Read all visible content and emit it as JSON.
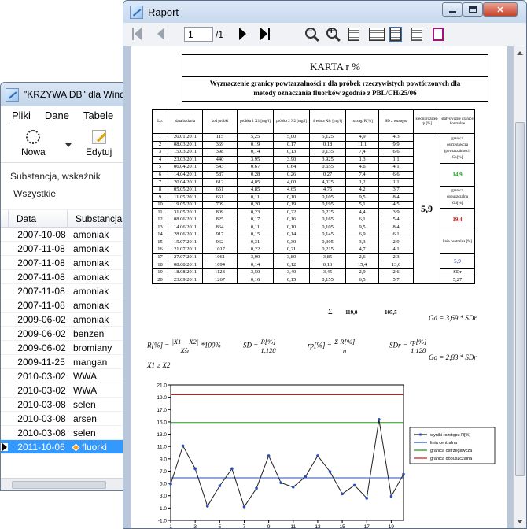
{
  "back_window": {
    "title": "\"KRZYWA DB\" dla Windo",
    "menu": [
      "Pliki",
      "Dane",
      "Tabele"
    ],
    "toolbar": {
      "new_label": "Nowa",
      "edit_label": "Edytuj"
    },
    "filter": {
      "label": "Substancja, wskaźnik",
      "value": "Wszystkie"
    },
    "grid": {
      "columns": [
        "Data",
        "Substancja"
      ],
      "rows": [
        {
          "date": "2007-10-08",
          "substance": "amoniak"
        },
        {
          "date": "2007-11-08",
          "substance": "amoniak"
        },
        {
          "date": "2007-11-08",
          "substance": "amoniak"
        },
        {
          "date": "2007-11-08",
          "substance": "amoniak"
        },
        {
          "date": "2007-11-08",
          "substance": "amoniak"
        },
        {
          "date": "2007-11-08",
          "substance": "amoniak"
        },
        {
          "date": "2009-06-02",
          "substance": "amoniak"
        },
        {
          "date": "2009-06-02",
          "substance": "benzen"
        },
        {
          "date": "2009-06-02",
          "substance": "bromiany"
        },
        {
          "date": "2009-11-25",
          "substance": "mangan"
        },
        {
          "date": "2010-03-02",
          "substance": "WWA"
        },
        {
          "date": "2010-03-02",
          "substance": "WWA"
        },
        {
          "date": "2010-03-08",
          "substance": "selen"
        },
        {
          "date": "2010-03-08",
          "substance": "arsen"
        },
        {
          "date": "2010-03-08",
          "substance": "selen"
        },
        {
          "date": "2011-10-06",
          "substance": "fluorki"
        }
      ]
    }
  },
  "front_window": {
    "title": "Raport",
    "toolbar": {
      "page_value": "1",
      "page_total": "/1"
    }
  },
  "report": {
    "title": "KARTA r %",
    "subtitle_line1": "Wyznaczenie granicy powtarzalności r dla próbek rzeczywistych powtórzonych dla",
    "subtitle_line2": "metody oznaczania fluorków zgodnie z  PBL/CH/25/06",
    "headers": {
      "lp": "Lp.",
      "date": "data badania",
      "code": "kod próbki",
      "x1": "próbka 1 X1 [mg/l]",
      "x2": "próbka 2 X2 [mg/l]",
      "mean": "średnia Xśr [mg/l]",
      "range": "rozstęp R[%]",
      "sd": "SD z rozstępu",
      "mean_range": "średni rozstęp rp [%]",
      "limits": "statystyczne granice kontrolne"
    },
    "rows": [
      {
        "lp": "1",
        "date": "20.01.2011",
        "code": "115",
        "x1": "5,25",
        "x2": "5,00",
        "mean": "5,125",
        "r": "4,9",
        "sd": "4,3"
      },
      {
        "lp": "2",
        "date": "08.03.2011",
        "code": "369",
        "x1": "0,19",
        "x2": "0,17",
        "mean": "0,18",
        "r": "11,1",
        "sd": "9,9"
      },
      {
        "lp": "3",
        "date": "15.03.2011",
        "code": "398",
        "x1": "0,14",
        "x2": "0,13",
        "mean": "0,135",
        "r": "7,4",
        "sd": "6,6"
      },
      {
        "lp": "4",
        "date": "23.03.2011",
        "code": "440",
        "x1": "3,95",
        "x2": "3,90",
        "mean": "3,925",
        "r": "1,3",
        "sd": "1,1"
      },
      {
        "lp": "5",
        "date": "06.04.2011",
        "code": "543",
        "x1": "0,67",
        "x2": "0,64",
        "mean": "0,655",
        "r": "4,6",
        "sd": "4,1"
      },
      {
        "lp": "6",
        "date": "14.04.2011",
        "code": "587",
        "x1": "0,28",
        "x2": "0,26",
        "mean": "0,27",
        "r": "7,4",
        "sd": "6,6"
      },
      {
        "lp": "7",
        "date": "20.04.2011",
        "code": "612",
        "x1": "4,05",
        "x2": "4,00",
        "mean": "4,025",
        "r": "1,2",
        "sd": "1,1"
      },
      {
        "lp": "8",
        "date": "05.05.2011",
        "code": "651",
        "x1": "4,85",
        "x2": "4,65",
        "mean": "4,75",
        "r": "4,2",
        "sd": "3,7"
      },
      {
        "lp": "9",
        "date": "11.05.2011",
        "code": "661",
        "x1": "0,11",
        "x2": "0,10",
        "mean": "0,105",
        "r": "9,5",
        "sd": "8,4"
      },
      {
        "lp": "10",
        "date": "19.05.2011",
        "code": "709",
        "x1": "0,20",
        "x2": "0,19",
        "mean": "0,195",
        "r": "5,1",
        "sd": "4,5"
      },
      {
        "lp": "11",
        "date": "31.05.2011",
        "code": "809",
        "x1": "0,23",
        "x2": "0,22",
        "mean": "0,225",
        "r": "4,4",
        "sd": "3,9"
      },
      {
        "lp": "12",
        "date": "08.06.2011",
        "code": "825",
        "x1": "0,17",
        "x2": "0,16",
        "mean": "0,165",
        "r": "6,1",
        "sd": "5,4"
      },
      {
        "lp": "13",
        "date": "14.06.2011",
        "code": "864",
        "x1": "0,11",
        "x2": "0,10",
        "mean": "0,105",
        "r": "9,5",
        "sd": "8,4"
      },
      {
        "lp": "14",
        "date": "28.06.2011",
        "code": "917",
        "x1": "0,15",
        "x2": "0,14",
        "mean": "0,145",
        "r": "6,9",
        "sd": "6,1"
      },
      {
        "lp": "15",
        "date": "15.07.2011",
        "code": "962",
        "x1": "0,31",
        "x2": "0,30",
        "mean": "0,305",
        "r": "3,3",
        "sd": "2,9"
      },
      {
        "lp": "16",
        "date": "21.07.2011",
        "code": "1017",
        "x1": "0,22",
        "x2": "0,21",
        "mean": "0,215",
        "r": "4,7",
        "sd": "4,1"
      },
      {
        "lp": "17",
        "date": "27.07.2011",
        "code": "1061",
        "x1": "3,90",
        "x2": "3,80",
        "mean": "3,85",
        "r": "2,6",
        "sd": "2,3"
      },
      {
        "lp": "18",
        "date": "08.08.2011",
        "code": "1094",
        "x1": "0,14",
        "x2": "0,12",
        "mean": "0,13",
        "r": "15,4",
        "sd": "13,6"
      },
      {
        "lp": "19",
        "date": "18.08.2011",
        "code": "1128",
        "x1": "3,50",
        "x2": "3,40",
        "mean": "3,45",
        "r": "2,9",
        "sd": "2,6"
      },
      {
        "lp": "20",
        "date": "23.09.2011",
        "code": "1267",
        "x1": "0,16",
        "x2": "0,15",
        "mean": "0,155",
        "r": "6,5",
        "sd": "5,7"
      }
    ],
    "mean_range_value": "5,9",
    "side": {
      "warning_label": "granica ostrzegawcza (powtarzalności) Go[%]",
      "warning_value": "14,9",
      "action_label": "granica dopuszczalna Gd[%]",
      "action_value": "19,4",
      "central_label": "linia centralna [%]",
      "central_value": "5,9",
      "sdr_label": "SDr",
      "sdr_value": "5,27"
    },
    "sums": {
      "symbol": "Σ",
      "r_sum": "119,0",
      "sd_sum": "105,5"
    },
    "formulas": {
      "gd": "Gd = 3,69 * SDr",
      "go": "Go = 2,83 * SDr",
      "r_lhs": "R[%] =",
      "r_num": "|X1 − X2|",
      "r_den": "Xśr",
      "r_tail": "*100%",
      "sd_lhs": "SD =",
      "sd_num": "R[%]",
      "sd_den": "1,128",
      "rp_lhs": "rp[%] =",
      "rp_num": "Σ R[%]",
      "rp_den": "n",
      "sdr_lhs": "SDr =",
      "sdr_num": "rp[%]",
      "sdr_den": "1,128",
      "cond": "X1 ≥ X2"
    }
  },
  "chart_data": {
    "type": "line",
    "x": [
      1,
      2,
      3,
      4,
      5,
      6,
      7,
      8,
      9,
      10,
      11,
      12,
      13,
      14,
      15,
      16,
      17,
      18,
      19,
      20
    ],
    "xticks": [
      "1",
      "3",
      "5",
      "7",
      "9",
      "11",
      "13",
      "15",
      "17",
      "19"
    ],
    "yticks": [
      "-1.0",
      "1.0",
      "3.0",
      "5.0",
      "7.0",
      "9.0",
      "11.0",
      "13.0",
      "15.0",
      "17.0",
      "19.0",
      "21.0"
    ],
    "ylim": [
      -1,
      21
    ],
    "series": [
      {
        "name": "wyniki rozstępu R[%]",
        "color": "#1f1f1f",
        "marker": "#2a4dc0",
        "values": [
          4.9,
          11.1,
          7.4,
          1.3,
          4.6,
          7.4,
          1.2,
          4.2,
          9.5,
          5.1,
          4.4,
          6.1,
          9.5,
          6.9,
          3.3,
          4.7,
          2.6,
          15.4,
          2.9,
          6.5
        ]
      },
      {
        "name": "linia centralna",
        "color": "#2a4dc0",
        "constant": 5.9
      },
      {
        "name": "granica ostrzegawcza",
        "color": "#1a9a1a",
        "constant": 14.9
      },
      {
        "name": "granica dopuszczalna",
        "color": "#d21a1a",
        "constant": 19.4
      }
    ],
    "legend_position": "right",
    "grid": false
  }
}
